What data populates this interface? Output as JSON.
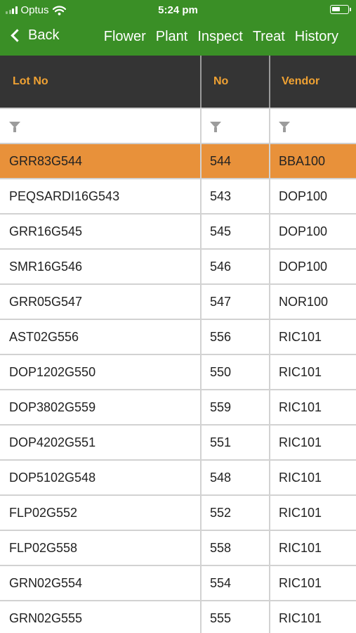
{
  "status_bar": {
    "carrier": "Optus",
    "time": "5:24 pm",
    "icons": [
      "signal-icon",
      "wifi-icon",
      "battery-icon"
    ]
  },
  "nav": {
    "back_label": "Back",
    "links": [
      "Flower",
      "Plant",
      "Inspect",
      "Treat",
      "History"
    ]
  },
  "table": {
    "columns": [
      "Lot No",
      "No",
      "Vendor"
    ],
    "filter_icon": "filter-icon",
    "selected_row": 0,
    "rows": [
      [
        "GRR83G544",
        "544",
        "BBA100"
      ],
      [
        "PEQSARDI16G543",
        "543",
        "DOP100"
      ],
      [
        "GRR16G545",
        "545",
        "DOP100"
      ],
      [
        "SMR16G546",
        "546",
        "DOP100"
      ],
      [
        "GRR05G547",
        "547",
        "NOR100"
      ],
      [
        "AST02G556",
        "556",
        "RIC101"
      ],
      [
        "DOP1202G550",
        "550",
        "RIC101"
      ],
      [
        "DOP3802G559",
        "559",
        "RIC101"
      ],
      [
        "DOP4202G551",
        "551",
        "RIC101"
      ],
      [
        "DOP5102G548",
        "548",
        "RIC101"
      ],
      [
        "FLP02G552",
        "552",
        "RIC101"
      ],
      [
        "FLP02G558",
        "558",
        "RIC101"
      ],
      [
        "GRN02G554",
        "554",
        "RIC101"
      ],
      [
        "GRN02G555",
        "555",
        "RIC101"
      ]
    ]
  },
  "colors": {
    "nav_bar": "#3a8f26",
    "header_bg": "#343434",
    "header_text": "#f0a233",
    "selected_row": "#e8913a"
  }
}
